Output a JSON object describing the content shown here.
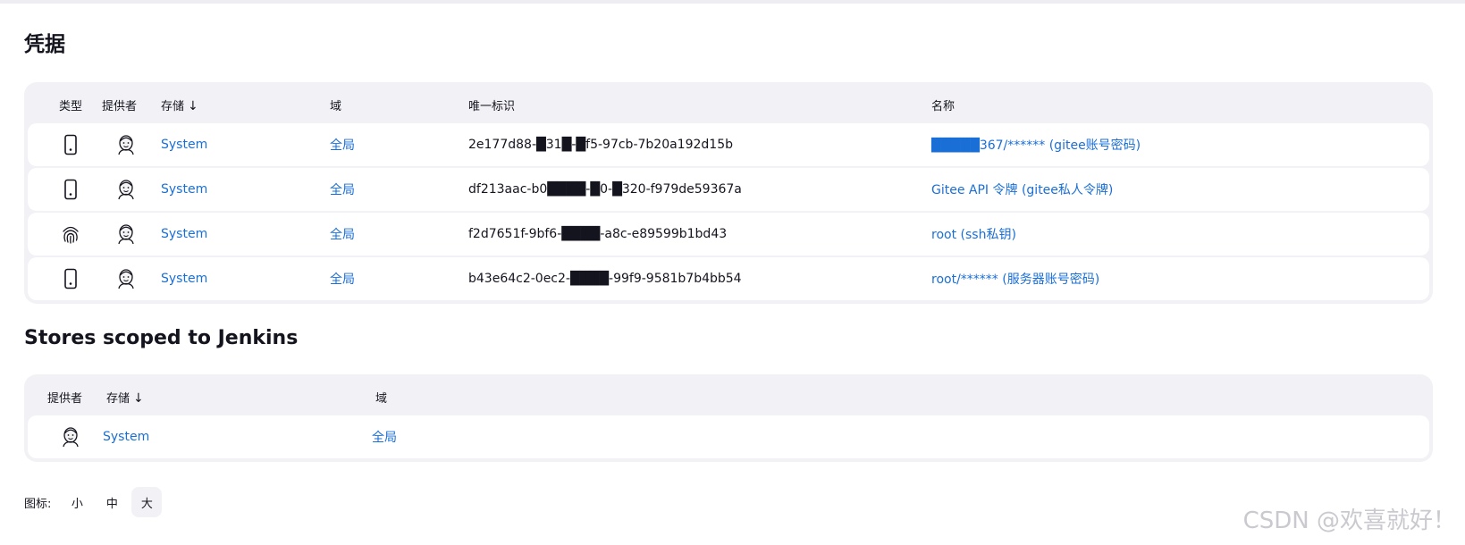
{
  "page": {
    "title": "凭据"
  },
  "credentials_table": {
    "headers": {
      "type": "类型",
      "provider": "提供者",
      "store": "存储",
      "sort_indicator": "↓",
      "domain": "域",
      "id": "唯一标识",
      "name": "名称"
    },
    "rows": [
      {
        "type_icon": "phone-icon",
        "provider_icon": "jenkins-icon",
        "store": "System",
        "domain": "全局",
        "id": "2e177d88-█31█-█f5-97cb-7b20a192d15b",
        "name": "█████367/****** (gitee账号密码)"
      },
      {
        "type_icon": "phone-icon",
        "provider_icon": "jenkins-icon",
        "store": "System",
        "domain": "全局",
        "id": "df213aac-b0████-█0-█320-f979de59367a",
        "name": "Gitee API 令牌 (gitee私人令牌)"
      },
      {
        "type_icon": "fingerprint-icon",
        "provider_icon": "jenkins-icon",
        "store": "System",
        "domain": "全局",
        "id": "f2d7651f-9bf6-████-a8c-e89599b1bd43",
        "name": "root (ssh私钥)"
      },
      {
        "type_icon": "phone-icon",
        "provider_icon": "jenkins-icon",
        "store": "System",
        "domain": "全局",
        "id": "b43e64c2-0ec2-████-99f9-9581b7b4bb54",
        "name": "root/****** (服务器账号密码)"
      }
    ]
  },
  "stores_section": {
    "title": "Stores scoped to Jenkins",
    "headers": {
      "provider": "提供者",
      "store": "存储",
      "sort_indicator": "↓",
      "domain": "域"
    },
    "rows": [
      {
        "provider_icon": "jenkins-icon",
        "store": "System",
        "domain": "全局"
      }
    ]
  },
  "icon_size": {
    "label": "图标:",
    "options": [
      "小",
      "中",
      "大"
    ],
    "selected": "大"
  },
  "watermark": "CSDN @欢喜就好！",
  "colors": {
    "link": "#1a6fd6",
    "card_bg": "#f2f2f6",
    "row_bg": "#ffffff",
    "text": "#14141f"
  }
}
